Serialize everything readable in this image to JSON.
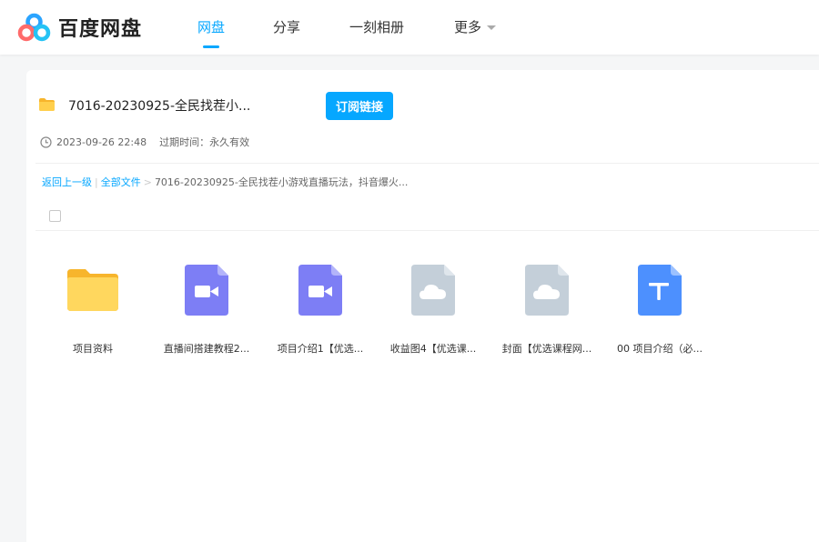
{
  "app": {
    "logo_text": "百度网盘"
  },
  "nav": {
    "items": [
      {
        "label": "网盘",
        "active": true
      },
      {
        "label": "分享"
      },
      {
        "label": "一刻相册"
      },
      {
        "label": "更多"
      }
    ]
  },
  "share": {
    "title": "7016-20230925-全民找茬小...",
    "subscribe_label": "订阅链接",
    "time": "2023-09-26 22:48",
    "expire_label": "过期时间：永久有效"
  },
  "breadcrumb": {
    "back": "返回上一级",
    "all_files": "全部文件",
    "current": "7016-20230925-全民找茬小游戏直播玩法，抖音爆火..."
  },
  "files": [
    {
      "name": "项目资料",
      "icon": "folder-icon"
    },
    {
      "name": "直播间搭建教程2...",
      "icon": "video-file-icon"
    },
    {
      "name": "项目介绍1【优选...",
      "icon": "video-file-icon"
    },
    {
      "name": "收益图4【优选课...",
      "icon": "cloud-file-icon"
    },
    {
      "name": "封面【优选课程网...",
      "icon": "cloud-file-icon"
    },
    {
      "name": "00 项目介绍（必...",
      "icon": "text-file-icon"
    }
  ],
  "colors": {
    "accent": "#06a7ff",
    "folder": "#ffd75e",
    "video": "#7d7ef5",
    "cloud_file": "#c4cfd9",
    "text_file": "#4d90fe"
  }
}
